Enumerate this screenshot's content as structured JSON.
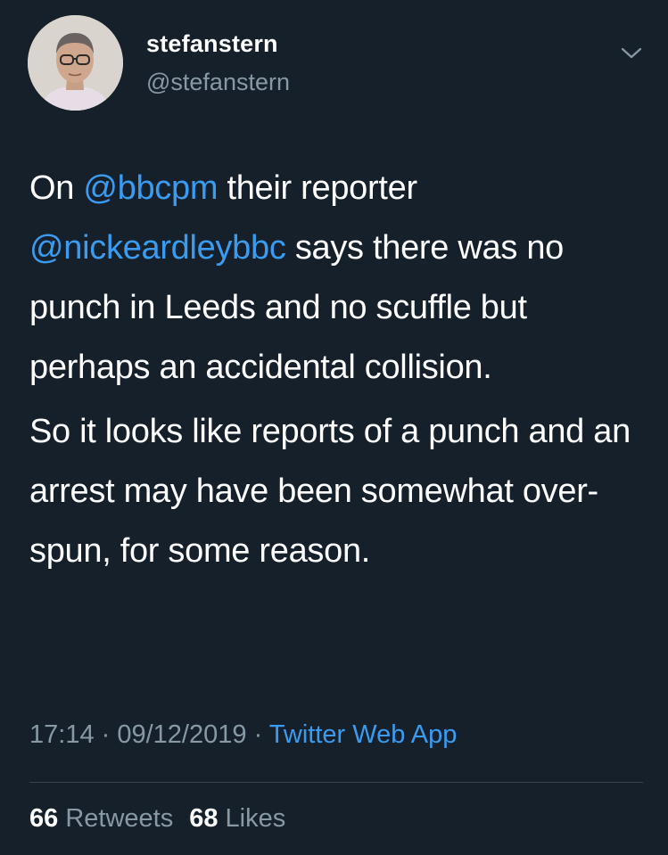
{
  "user": {
    "display_name": "stefanstern",
    "handle": "@stefanstern"
  },
  "menu": {
    "icon": "chevron-down-icon"
  },
  "tweet": {
    "paragraph1": {
      "prefix": "On ",
      "mention1": "@bbcpm",
      "middle": " their reporter ",
      "mention2": "@nickeardleybbc",
      "suffix": " says there was no punch in Leeds and no scuffle but perhaps an accidental collision."
    },
    "paragraph2": "So it looks like reports of a punch and an arrest may have been somewhat over-spun, for some reason."
  },
  "meta": {
    "time": "17:14",
    "separator1": " · ",
    "date": "09/12/2019",
    "separator2": " · ",
    "source": "Twitter Web App"
  },
  "stats": {
    "retweets_count": "66",
    "retweets_label": "Retweets",
    "likes_count": "68",
    "likes_label": "Likes"
  },
  "colors": {
    "background": "#15202b",
    "link": "#3a9cf0",
    "secondary_text": "#8899a6",
    "divider": "#38444d"
  }
}
